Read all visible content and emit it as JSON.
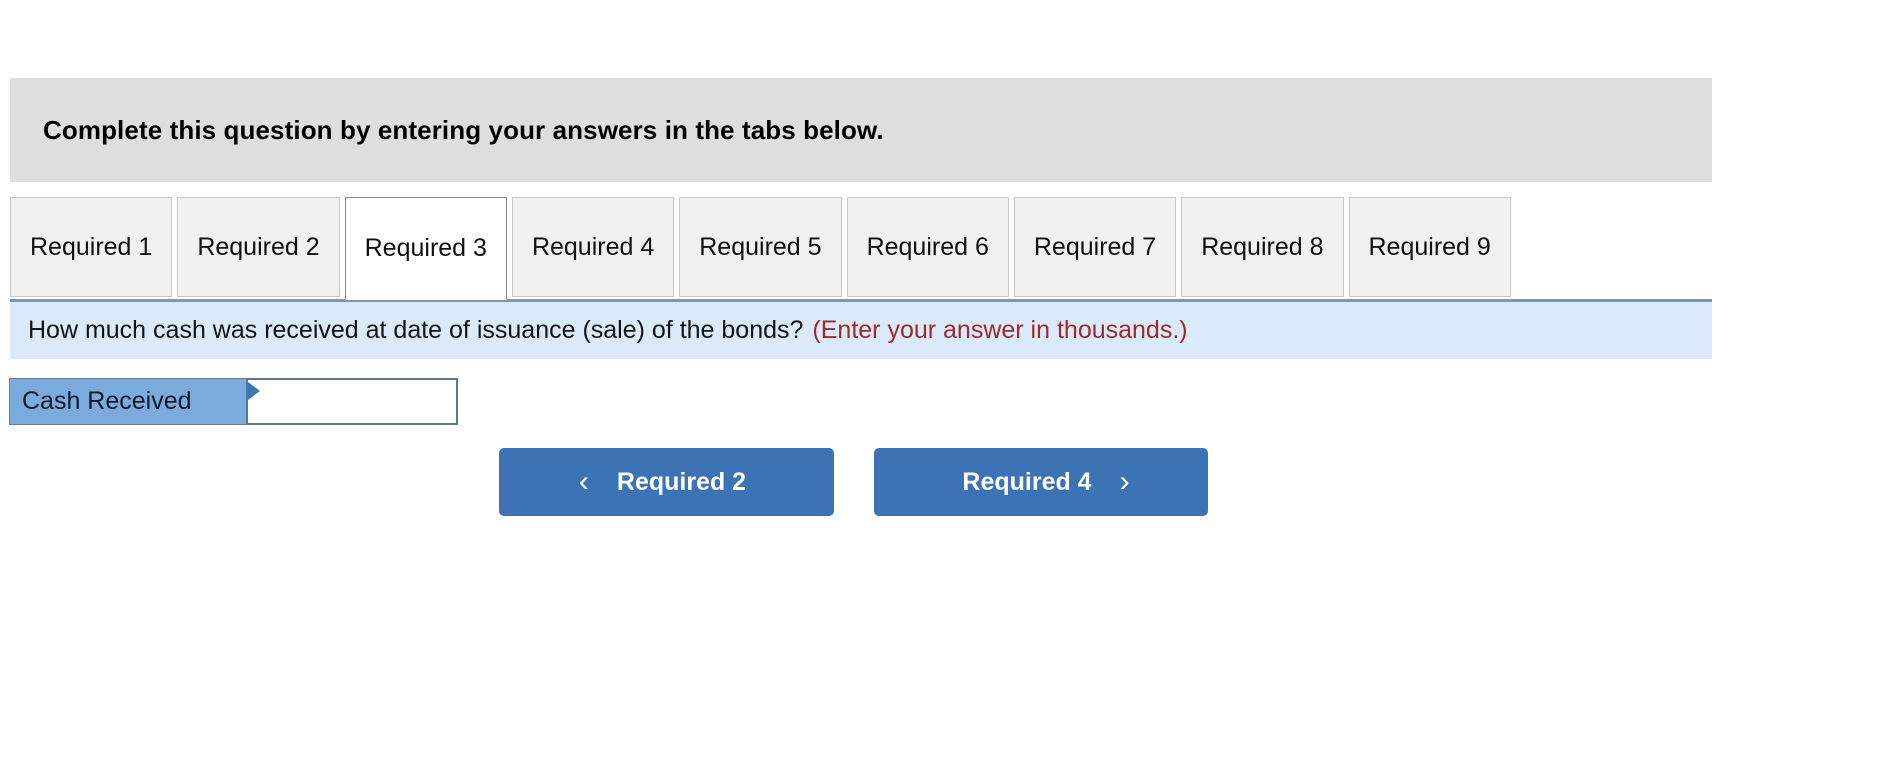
{
  "top_artifact": {
    "text": "."
  },
  "instruction": {
    "text": "Complete this question by entering your answers in the tabs below."
  },
  "tabs": {
    "active_index": 2,
    "items": [
      {
        "label": "Required 1",
        "name": "tab-required-1"
      },
      {
        "label": "Required 2",
        "name": "tab-required-2"
      },
      {
        "label": "Required 3",
        "name": "tab-required-3"
      },
      {
        "label": "Required 4",
        "name": "tab-required-4"
      },
      {
        "label": "Required 5",
        "name": "tab-required-5"
      },
      {
        "label": "Required 6",
        "name": "tab-required-6"
      },
      {
        "label": "Required 7",
        "name": "tab-required-7"
      },
      {
        "label": "Required 8",
        "name": "tab-required-8"
      },
      {
        "label": "Required 9",
        "name": "tab-required-9"
      }
    ]
  },
  "question": {
    "prompt": "How much cash was received at date of issuance (sale) of the bonds?",
    "hint": "(Enter your answer in thousands.)",
    "hint_color": "#9e2b2b",
    "background_color": "#dbeafa"
  },
  "answer": {
    "label": "Cash Received",
    "value": "",
    "placeholder": "",
    "label_background": "#7babdd",
    "marker_color": "#3e76b4"
  },
  "navigation": {
    "prev_label": "Required 2",
    "next_label": "Required 4",
    "prev_icon": "chevron-left-icon",
    "next_icon": "chevron-right-icon",
    "prev_glyph": "‹",
    "next_glyph": "›",
    "button_color": "#3c73b4"
  }
}
